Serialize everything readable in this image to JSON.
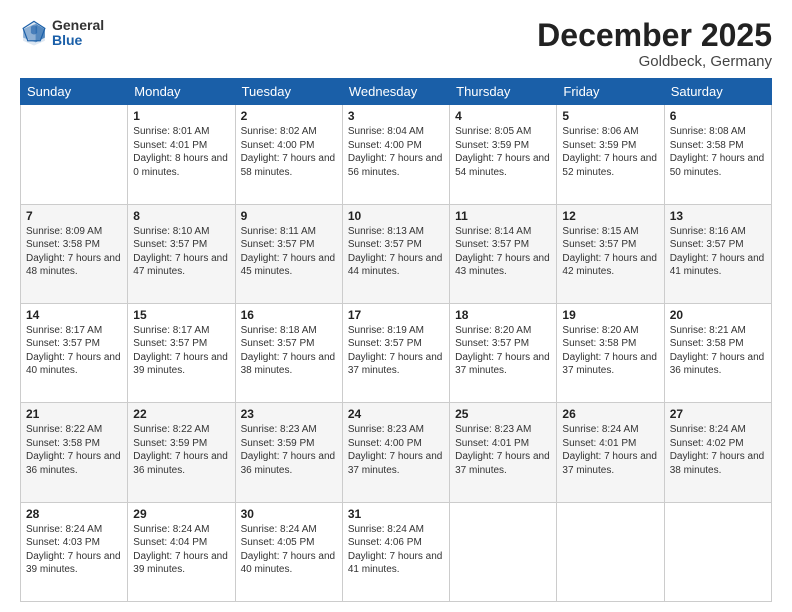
{
  "logo": {
    "general": "General",
    "blue": "Blue"
  },
  "header": {
    "month": "December 2025",
    "location": "Goldbeck, Germany"
  },
  "weekdays": [
    "Sunday",
    "Monday",
    "Tuesday",
    "Wednesday",
    "Thursday",
    "Friday",
    "Saturday"
  ],
  "weeks": [
    [
      {
        "day": "",
        "sunrise": "",
        "sunset": "",
        "daylight": ""
      },
      {
        "day": "1",
        "sunrise": "Sunrise: 8:01 AM",
        "sunset": "Sunset: 4:01 PM",
        "daylight": "Daylight: 8 hours and 0 minutes."
      },
      {
        "day": "2",
        "sunrise": "Sunrise: 8:02 AM",
        "sunset": "Sunset: 4:00 PM",
        "daylight": "Daylight: 7 hours and 58 minutes."
      },
      {
        "day": "3",
        "sunrise": "Sunrise: 8:04 AM",
        "sunset": "Sunset: 4:00 PM",
        "daylight": "Daylight: 7 hours and 56 minutes."
      },
      {
        "day": "4",
        "sunrise": "Sunrise: 8:05 AM",
        "sunset": "Sunset: 3:59 PM",
        "daylight": "Daylight: 7 hours and 54 minutes."
      },
      {
        "day": "5",
        "sunrise": "Sunrise: 8:06 AM",
        "sunset": "Sunset: 3:59 PM",
        "daylight": "Daylight: 7 hours and 52 minutes."
      },
      {
        "day": "6",
        "sunrise": "Sunrise: 8:08 AM",
        "sunset": "Sunset: 3:58 PM",
        "daylight": "Daylight: 7 hours and 50 minutes."
      }
    ],
    [
      {
        "day": "7",
        "sunrise": "Sunrise: 8:09 AM",
        "sunset": "Sunset: 3:58 PM",
        "daylight": "Daylight: 7 hours and 48 minutes."
      },
      {
        "day": "8",
        "sunrise": "Sunrise: 8:10 AM",
        "sunset": "Sunset: 3:57 PM",
        "daylight": "Daylight: 7 hours and 47 minutes."
      },
      {
        "day": "9",
        "sunrise": "Sunrise: 8:11 AM",
        "sunset": "Sunset: 3:57 PM",
        "daylight": "Daylight: 7 hours and 45 minutes."
      },
      {
        "day": "10",
        "sunrise": "Sunrise: 8:13 AM",
        "sunset": "Sunset: 3:57 PM",
        "daylight": "Daylight: 7 hours and 44 minutes."
      },
      {
        "day": "11",
        "sunrise": "Sunrise: 8:14 AM",
        "sunset": "Sunset: 3:57 PM",
        "daylight": "Daylight: 7 hours and 43 minutes."
      },
      {
        "day": "12",
        "sunrise": "Sunrise: 8:15 AM",
        "sunset": "Sunset: 3:57 PM",
        "daylight": "Daylight: 7 hours and 42 minutes."
      },
      {
        "day": "13",
        "sunrise": "Sunrise: 8:16 AM",
        "sunset": "Sunset: 3:57 PM",
        "daylight": "Daylight: 7 hours and 41 minutes."
      }
    ],
    [
      {
        "day": "14",
        "sunrise": "Sunrise: 8:17 AM",
        "sunset": "Sunset: 3:57 PM",
        "daylight": "Daylight: 7 hours and 40 minutes."
      },
      {
        "day": "15",
        "sunrise": "Sunrise: 8:17 AM",
        "sunset": "Sunset: 3:57 PM",
        "daylight": "Daylight: 7 hours and 39 minutes."
      },
      {
        "day": "16",
        "sunrise": "Sunrise: 8:18 AM",
        "sunset": "Sunset: 3:57 PM",
        "daylight": "Daylight: 7 hours and 38 minutes."
      },
      {
        "day": "17",
        "sunrise": "Sunrise: 8:19 AM",
        "sunset": "Sunset: 3:57 PM",
        "daylight": "Daylight: 7 hours and 37 minutes."
      },
      {
        "day": "18",
        "sunrise": "Sunrise: 8:20 AM",
        "sunset": "Sunset: 3:57 PM",
        "daylight": "Daylight: 7 hours and 37 minutes."
      },
      {
        "day": "19",
        "sunrise": "Sunrise: 8:20 AM",
        "sunset": "Sunset: 3:58 PM",
        "daylight": "Daylight: 7 hours and 37 minutes."
      },
      {
        "day": "20",
        "sunrise": "Sunrise: 8:21 AM",
        "sunset": "Sunset: 3:58 PM",
        "daylight": "Daylight: 7 hours and 36 minutes."
      }
    ],
    [
      {
        "day": "21",
        "sunrise": "Sunrise: 8:22 AM",
        "sunset": "Sunset: 3:58 PM",
        "daylight": "Daylight: 7 hours and 36 minutes."
      },
      {
        "day": "22",
        "sunrise": "Sunrise: 8:22 AM",
        "sunset": "Sunset: 3:59 PM",
        "daylight": "Daylight: 7 hours and 36 minutes."
      },
      {
        "day": "23",
        "sunrise": "Sunrise: 8:23 AM",
        "sunset": "Sunset: 3:59 PM",
        "daylight": "Daylight: 7 hours and 36 minutes."
      },
      {
        "day": "24",
        "sunrise": "Sunrise: 8:23 AM",
        "sunset": "Sunset: 4:00 PM",
        "daylight": "Daylight: 7 hours and 37 minutes."
      },
      {
        "day": "25",
        "sunrise": "Sunrise: 8:23 AM",
        "sunset": "Sunset: 4:01 PM",
        "daylight": "Daylight: 7 hours and 37 minutes."
      },
      {
        "day": "26",
        "sunrise": "Sunrise: 8:24 AM",
        "sunset": "Sunset: 4:01 PM",
        "daylight": "Daylight: 7 hours and 37 minutes."
      },
      {
        "day": "27",
        "sunrise": "Sunrise: 8:24 AM",
        "sunset": "Sunset: 4:02 PM",
        "daylight": "Daylight: 7 hours and 38 minutes."
      }
    ],
    [
      {
        "day": "28",
        "sunrise": "Sunrise: 8:24 AM",
        "sunset": "Sunset: 4:03 PM",
        "daylight": "Daylight: 7 hours and 39 minutes."
      },
      {
        "day": "29",
        "sunrise": "Sunrise: 8:24 AM",
        "sunset": "Sunset: 4:04 PM",
        "daylight": "Daylight: 7 hours and 39 minutes."
      },
      {
        "day": "30",
        "sunrise": "Sunrise: 8:24 AM",
        "sunset": "Sunset: 4:05 PM",
        "daylight": "Daylight: 7 hours and 40 minutes."
      },
      {
        "day": "31",
        "sunrise": "Sunrise: 8:24 AM",
        "sunset": "Sunset: 4:06 PM",
        "daylight": "Daylight: 7 hours and 41 minutes."
      },
      {
        "day": "",
        "sunrise": "",
        "sunset": "",
        "daylight": ""
      },
      {
        "day": "",
        "sunrise": "",
        "sunset": "",
        "daylight": ""
      },
      {
        "day": "",
        "sunrise": "",
        "sunset": "",
        "daylight": ""
      }
    ]
  ]
}
